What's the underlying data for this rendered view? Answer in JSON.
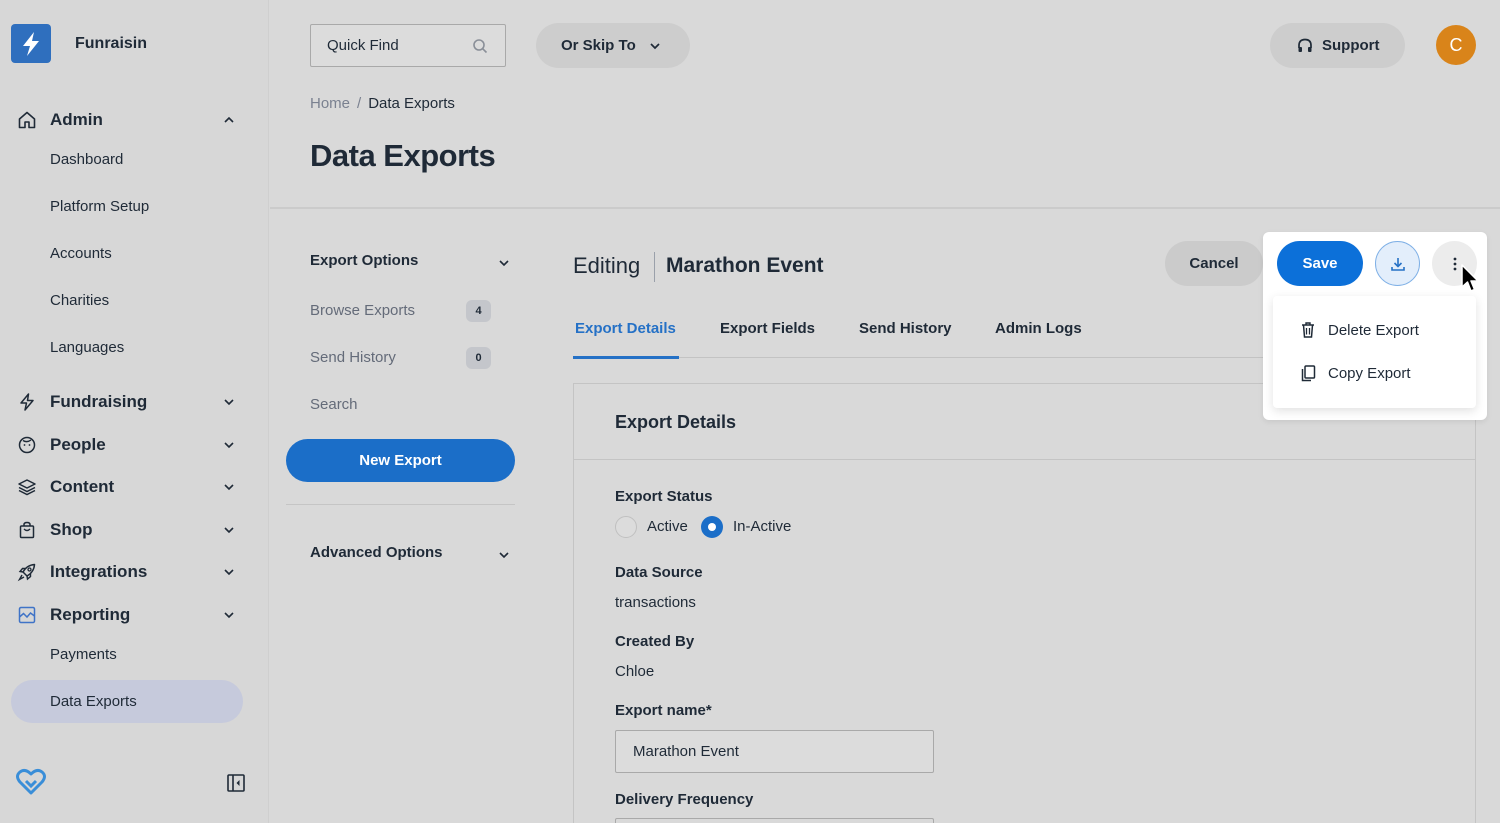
{
  "brand": {
    "name": "Funraisin"
  },
  "sidebar": {
    "sections": [
      {
        "label": "Admin",
        "icon": "home-icon",
        "expanded": true
      },
      {
        "label": "Fundraising",
        "icon": "bolt-icon",
        "expanded": false
      },
      {
        "label": "People",
        "icon": "face-icon",
        "expanded": false
      },
      {
        "label": "Content",
        "icon": "layers-icon",
        "expanded": false
      },
      {
        "label": "Shop",
        "icon": "shopping-bag-icon",
        "expanded": false
      },
      {
        "label": "Integrations",
        "icon": "rocket-icon",
        "expanded": false
      },
      {
        "label": "Reporting",
        "icon": "chart-icon",
        "expanded": true
      }
    ],
    "admin_items": [
      "Dashboard",
      "Platform Setup",
      "Accounts",
      "Charities",
      "Languages"
    ],
    "reporting_items": [
      "Payments",
      "Data Exports"
    ],
    "active_item": "Data Exports"
  },
  "header": {
    "quick_find_placeholder": "Quick Find",
    "skip_to_label": "Or Skip To",
    "support_label": "Support",
    "avatar_initial": "C"
  },
  "breadcrumb": {
    "home": "Home",
    "separator": "/",
    "current": "Data Exports"
  },
  "page_title": "Data Exports",
  "options": {
    "export_options_heading": "Export Options",
    "browse_exports_label": "Browse Exports",
    "browse_exports_count": "4",
    "send_history_label": "Send History",
    "send_history_count": "0",
    "search_label": "Search",
    "new_export_label": "New Export",
    "advanced_options_heading": "Advanced Options"
  },
  "editor": {
    "editing_label": "Editing",
    "export_name": "Marathon Event",
    "cancel_label": "Cancel",
    "save_label": "Save",
    "tabs": [
      "Export Details",
      "Export Fields",
      "Send History",
      "Admin Logs"
    ],
    "active_tab": "Export Details"
  },
  "menu": {
    "items": [
      {
        "label": "Delete Export",
        "icon": "trash-icon"
      },
      {
        "label": "Copy Export",
        "icon": "copy-icon"
      }
    ]
  },
  "form": {
    "panel_title": "Export Details",
    "status_label": "Export Status",
    "status_options": [
      "Active",
      "In-Active"
    ],
    "status_selected": "In-Active",
    "data_source_label": "Data Source",
    "data_source_value": "transactions",
    "created_by_label": "Created By",
    "created_by_value": "Chloe",
    "export_name_label": "Export name*",
    "export_name_value": "Marathon Event",
    "delivery_frequency_label": "Delivery Frequency"
  },
  "colors": {
    "primary": "#0c70d9",
    "accent_tab": "#2571c6",
    "avatar": "#d9841a",
    "brand_logo": "#2f6fbe"
  }
}
